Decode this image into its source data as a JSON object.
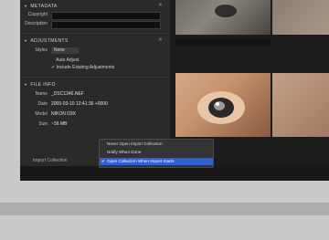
{
  "metadata": {
    "header": "METADATA",
    "copyright_label": "Copyright",
    "description_label": "Description"
  },
  "adjustments": {
    "header": "ADJUSTMENTS",
    "styles_label": "Styles",
    "styles_value": "None",
    "auto_adjust": "Auto Adjust",
    "include_existing": "Include Existing Adjustments"
  },
  "file_info": {
    "header": "FILE INFO",
    "rows": [
      {
        "label": "Name",
        "value": "_DSC1346.NEF"
      },
      {
        "label": "Date",
        "value": "2005-03-10 12:41:36 +0000"
      },
      {
        "label": "Model",
        "value": "NIKON D3X"
      },
      {
        "label": "Size",
        "value": "~36 MB"
      }
    ]
  },
  "import": {
    "label": "Import Collection",
    "menu": [
      {
        "label": "Never Open Import Collection",
        "checked": false
      },
      {
        "label": "Notify When Done",
        "checked": false
      },
      {
        "label": "Open Collection When Import Starts",
        "checked": true
      }
    ]
  },
  "colors": {
    "accent": "#f0a030",
    "selection": "#2f5fd0",
    "panel": "#2a2a2a"
  }
}
